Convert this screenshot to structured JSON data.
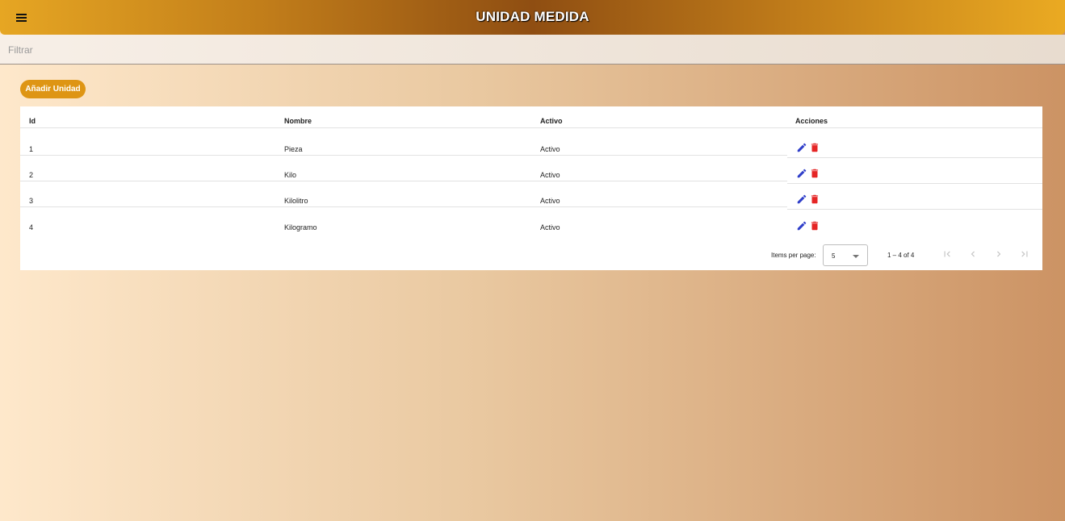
{
  "header": {
    "title": "UNIDAD MEDIDA",
    "menu_icon": "menu-icon"
  },
  "filter": {
    "placeholder": "Filtrar",
    "value": ""
  },
  "add_button": {
    "label": "Añadir Unidad"
  },
  "table": {
    "columns": [
      "Id",
      "Nombre",
      "Activo",
      "Acciones"
    ],
    "rows": [
      {
        "id": "1",
        "nombre": "Pieza",
        "activo": "Activo"
      },
      {
        "id": "2",
        "nombre": "Kilo",
        "activo": "Activo"
      },
      {
        "id": "3",
        "nombre": "Kilolitro",
        "activo": "Activo"
      },
      {
        "id": "4",
        "nombre": "Kilogramo",
        "activo": "Activo"
      }
    ],
    "action_icons": [
      "edit-icon",
      "delete-icon"
    ]
  },
  "paginator": {
    "items_per_page_label": "Items per page:",
    "page_size": "5",
    "range_label": "1 – 4 of 4",
    "nav_icons": [
      "first-page-icon",
      "previous-page-icon",
      "next-page-icon",
      "last-page-icon"
    ]
  },
  "colors": {
    "accent": "#de9514",
    "edit_icon": "#2f3ec9",
    "delete_icon": "#e52525",
    "toolbar_dark": "#8f4e12",
    "toolbar_light": "#e6a623"
  }
}
